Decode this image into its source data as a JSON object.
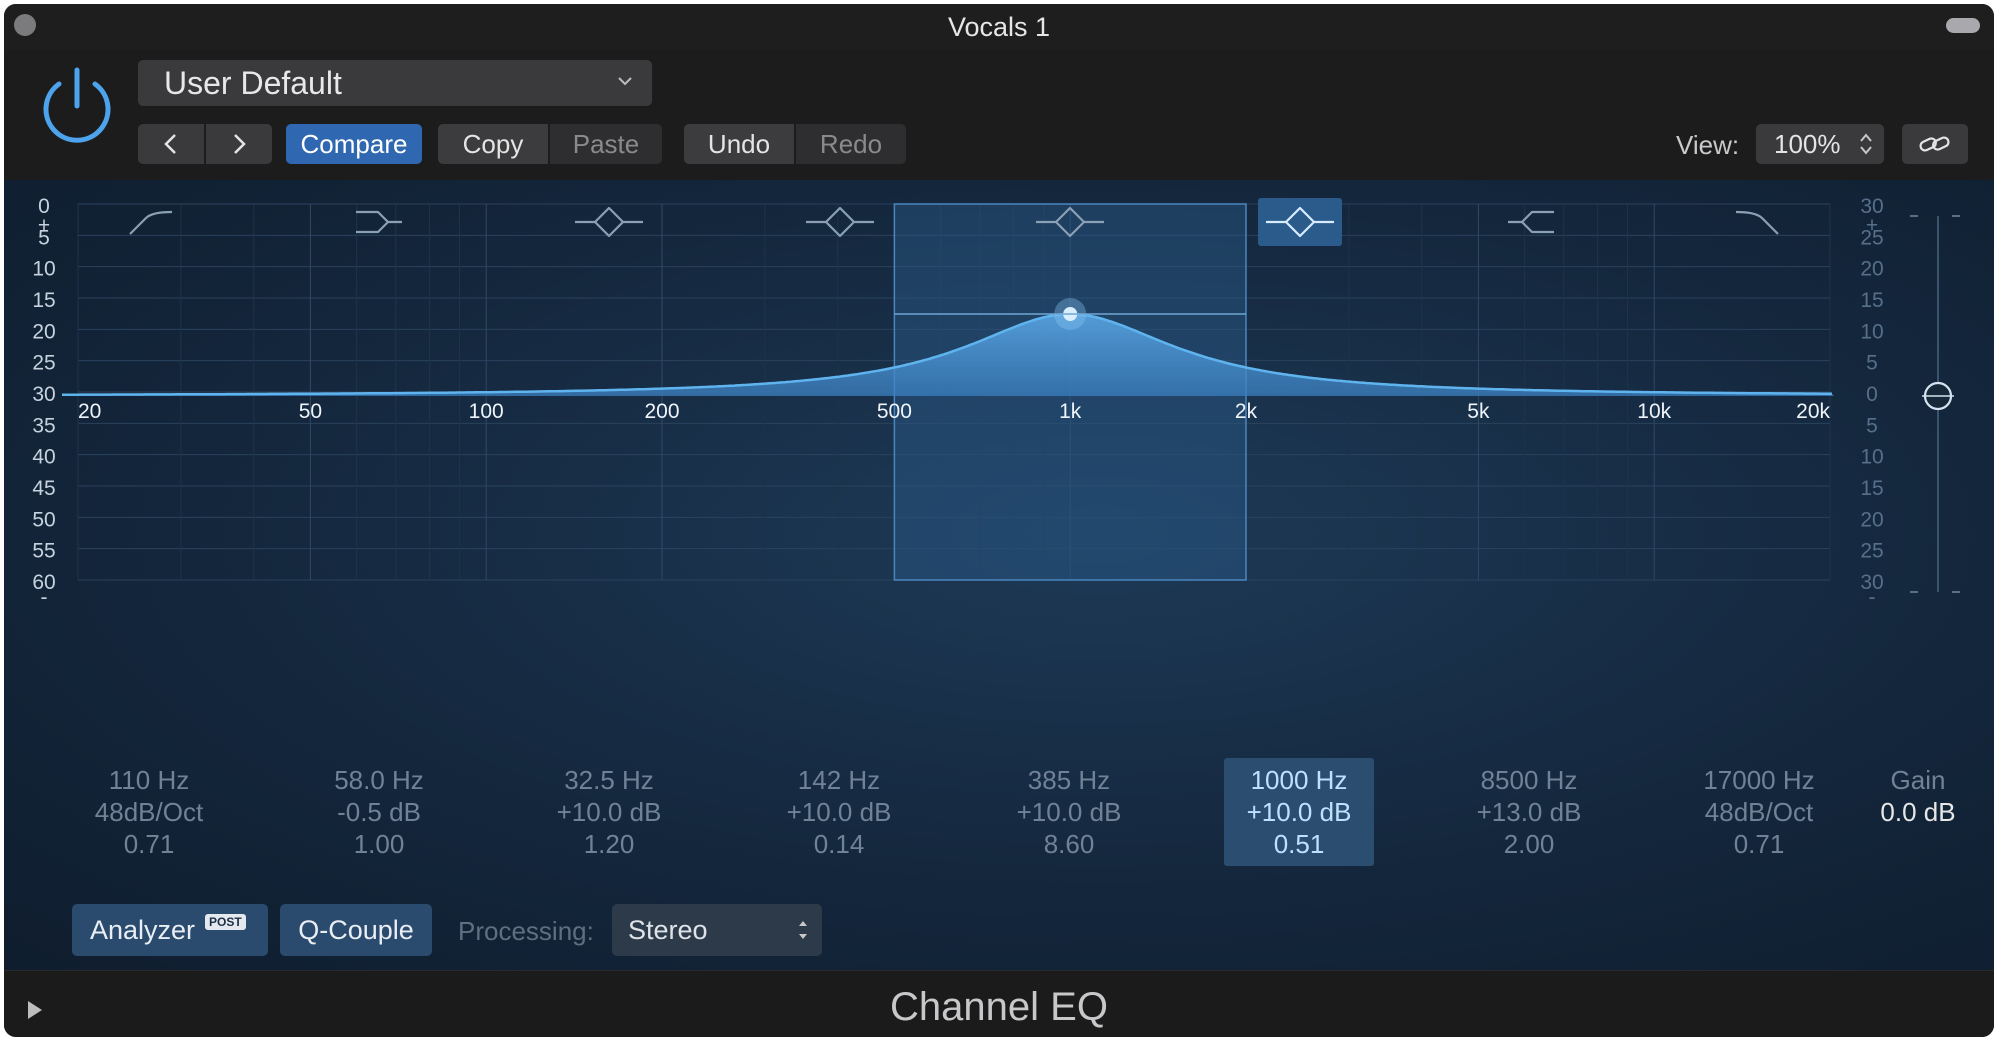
{
  "window": {
    "title": "Vocals 1"
  },
  "header": {
    "preset": "User Default",
    "compare_label": "Compare",
    "copy_label": "Copy",
    "paste_label": "Paste",
    "undo_label": "Undo",
    "redo_label": "Redo",
    "view_label": "View:",
    "zoom": "100%"
  },
  "graph": {
    "left_scale": [
      "+",
      "0",
      "5",
      "10",
      "15",
      "20",
      "25",
      "30",
      "35",
      "40",
      "45",
      "50",
      "55",
      "60",
      "-"
    ],
    "right_scale": [
      "+",
      "30",
      "25",
      "20",
      "15",
      "10",
      "5",
      "0",
      "5",
      "10",
      "15",
      "20",
      "25",
      "30",
      "-"
    ],
    "freq_labels": [
      "20",
      "50",
      "100",
      "200",
      "500",
      "1k",
      "2k",
      "5k",
      "10k",
      "20k"
    ],
    "colors": {
      "curve": "#5fb4ef",
      "fill": "#3f86c4",
      "selected_band": "#2b5b8a"
    }
  },
  "bands": [
    {
      "freq": "110 Hz",
      "gain": "48dB/Oct",
      "q": "0.71",
      "icon": "low-cut-icon"
    },
    {
      "freq": "58.0 Hz",
      "gain": "-0.5 dB",
      "q": "1.00",
      "icon": "low-shelf-icon"
    },
    {
      "freq": "32.5 Hz",
      "gain": "+10.0 dB",
      "q": "1.20",
      "icon": "bell-icon"
    },
    {
      "freq": "142 Hz",
      "gain": "+10.0 dB",
      "q": "0.14",
      "icon": "bell-icon"
    },
    {
      "freq": "385 Hz",
      "gain": "+10.0 dB",
      "q": "8.60",
      "icon": "bell-icon"
    },
    {
      "freq": "1000 Hz",
      "gain": "+10.0 dB",
      "q": "0.51",
      "icon": "bell-icon",
      "selected": true
    },
    {
      "freq": "8500 Hz",
      "gain": "+13.0 dB",
      "q": "2.00",
      "icon": "high-shelf-icon"
    },
    {
      "freq": "17000 Hz",
      "gain": "48dB/Oct",
      "q": "0.71",
      "icon": "high-cut-icon"
    }
  ],
  "gain": {
    "label": "Gain",
    "value": "0.0 dB"
  },
  "bottom": {
    "analyzer_label": "Analyzer",
    "analyzer_badge": "POST",
    "qcouple_label": "Q-Couple",
    "processing_label": "Processing:",
    "processing_value": "Stereo"
  },
  "footer": {
    "title": "Channel EQ"
  }
}
